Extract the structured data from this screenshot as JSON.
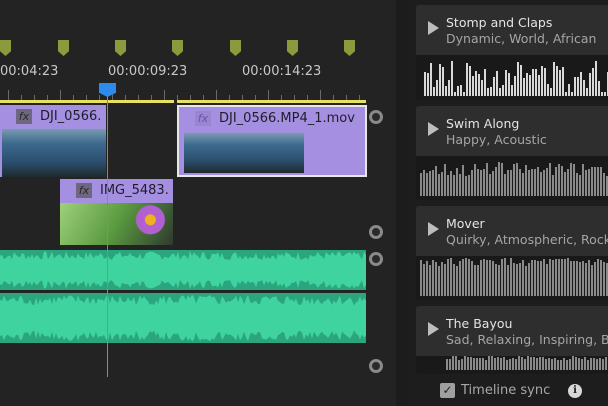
{
  "timeline": {
    "time_labels": [
      "00:04:23",
      "00:00:09:23",
      "00:00:14:23"
    ],
    "clips": [
      {
        "name": "DJI_0566.",
        "fx": "fx"
      },
      {
        "name": "DJI_0566.MP4_1.mov",
        "fx": "fx"
      },
      {
        "name": "IMG_5483.",
        "fx": "fx"
      }
    ],
    "colors": {
      "clip": "#a58fe0",
      "audio": "#2aa57e",
      "playhead": "#2d8ceb",
      "work_area": "#e8e060"
    }
  },
  "music_panel": {
    "tracks": [
      {
        "title": "Stomp and Claps",
        "tags": "Dynamic, World, African"
      },
      {
        "title": "Swim Along",
        "tags": "Happy, Acoustic"
      },
      {
        "title": "Mover",
        "tags": "Quirky, Atmospheric, Rock, C"
      },
      {
        "title": "The Bayou",
        "tags": "Sad, Relaxing, Inspiring, Blue"
      }
    ],
    "timeline_sync_label": "Timeline sync",
    "timeline_sync_checked": true,
    "info_icon": "i"
  }
}
